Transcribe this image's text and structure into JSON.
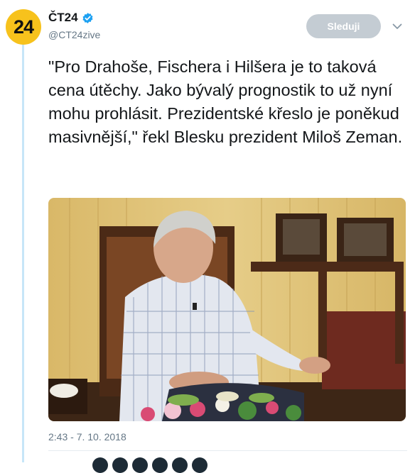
{
  "account": {
    "display_name": "ČT24",
    "handle": "@CT24zive",
    "avatar_text": "24",
    "verified": true,
    "brand_color": "#f7c21c",
    "verified_color": "#1da1f2"
  },
  "actions": {
    "follow_label": "Sleduji",
    "menu_icon": "chevron-down-icon"
  },
  "tweet": {
    "text": "\"Pro Drahoše, Fischera i Hilšera je to taková cena útěchy. Jako bývalý prognostik to už nyní mohu prohlásit. Prezidentské křeslo je poněkud masivnější,\" řekl Blesku prezident Miloš Zeman.",
    "timestamp": "2:43 - 7. 10. 2018"
  }
}
